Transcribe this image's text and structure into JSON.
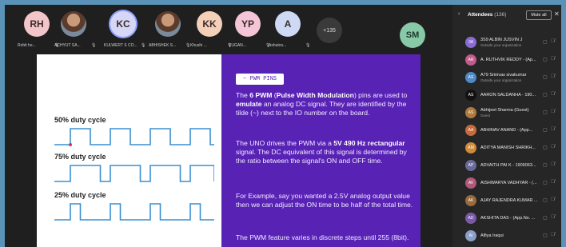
{
  "participants": [
    {
      "initials": "RH",
      "name": "Rohit he...",
      "color": "#f2c6c8",
      "photo": false
    },
    {
      "initials": "",
      "name": "ACHYUT SA...",
      "color": "#b08060",
      "photo": true
    },
    {
      "initials": "KC",
      "name": "KULWERT S CO...",
      "color": "#d5d7f5",
      "photo": false,
      "active": true
    },
    {
      "initials": "",
      "name": "ABHISHEK S...",
      "color": "#a07050",
      "photo": true
    },
    {
      "initials": "KK",
      "name": "Khushi ...",
      "color": "#f5d0b8",
      "photo": false
    },
    {
      "initials": "YP",
      "name": "YUGAN...",
      "color": "#f3c5d6",
      "photo": false
    },
    {
      "initials": "A",
      "name": "Ashutos...",
      "color": "#cdd9f5",
      "photo": false
    }
  ],
  "more_count": "+135",
  "self_avatar": "SM",
  "slide": {
    "tag": "~ PWM PINS",
    "waves": [
      {
        "label": "50% duty cycle",
        "duty": 0.5
      },
      {
        "label": "75% duty cycle",
        "duty": 0.75
      },
      {
        "label": "25% duty cycle",
        "duty": 0.25
      }
    ],
    "p1": {
      "t1": "The ",
      "b1": "6 PWM",
      "t2": " (",
      "b2": "Pulse Width Modulation",
      "t3": ") pins are used to ",
      "b3": "emulate",
      "t4": " an analog DC signal. They are identified by the tilde (~) next to the IO number on the board."
    },
    "p2": {
      "t1": "The UNO drives the PWM via a ",
      "b1": "5V 490 Hz rectangular",
      "t2": " signal. The DC equivalent of this signal is determined by the ratio between the signal's ON and OFF time."
    },
    "p3": "For Example, say you wanted a 2.5V analog output value then we can adjust the ON time to be half of the total time.",
    "p4": "The PWM feature varies in discrete steps until 255 (8bit)."
  },
  "attendees": {
    "title": "Attendees",
    "count": "(136)",
    "mute_all": "Mute all",
    "list": [
      {
        "initials": "3A",
        "name": "3S9 ALBIN JUSVIN J",
        "sub": "Outside your organization"
      },
      {
        "initials": "AR",
        "name": "A. RUTHVIK REDDY - (Ap...",
        "sub": ""
      },
      {
        "initials": "AS",
        "name": "A79 Srinivas sivakumar",
        "sub": "Outside your organization"
      },
      {
        "initials": "AS",
        "name": "AARON SALDANHA - 190...",
        "sub": ""
      },
      {
        "initials": "AS",
        "name": "Abhijeet Sharma (Guest)",
        "sub": "Guest"
      },
      {
        "initials": "AA",
        "name": "ABHINAV ANAND - (App...",
        "sub": ""
      },
      {
        "initials": "AM",
        "name": "ADITYA MANISH SHRIKH...",
        "sub": ""
      },
      {
        "initials": "AP",
        "name": "ADVAITH PAI K - 1909063...",
        "sub": ""
      },
      {
        "initials": "AV",
        "name": "AISHWARYA VADHYAR - (...",
        "sub": ""
      },
      {
        "initials": "AK",
        "name": "AJAY RAJENDRA KUMAR ...",
        "sub": ""
      },
      {
        "initials": "AD",
        "name": "AKSHITA DAS - (App.No. ...",
        "sub": ""
      },
      {
        "initials": "AI",
        "name": "Alfiya Iraqui",
        "sub": ""
      }
    ]
  }
}
